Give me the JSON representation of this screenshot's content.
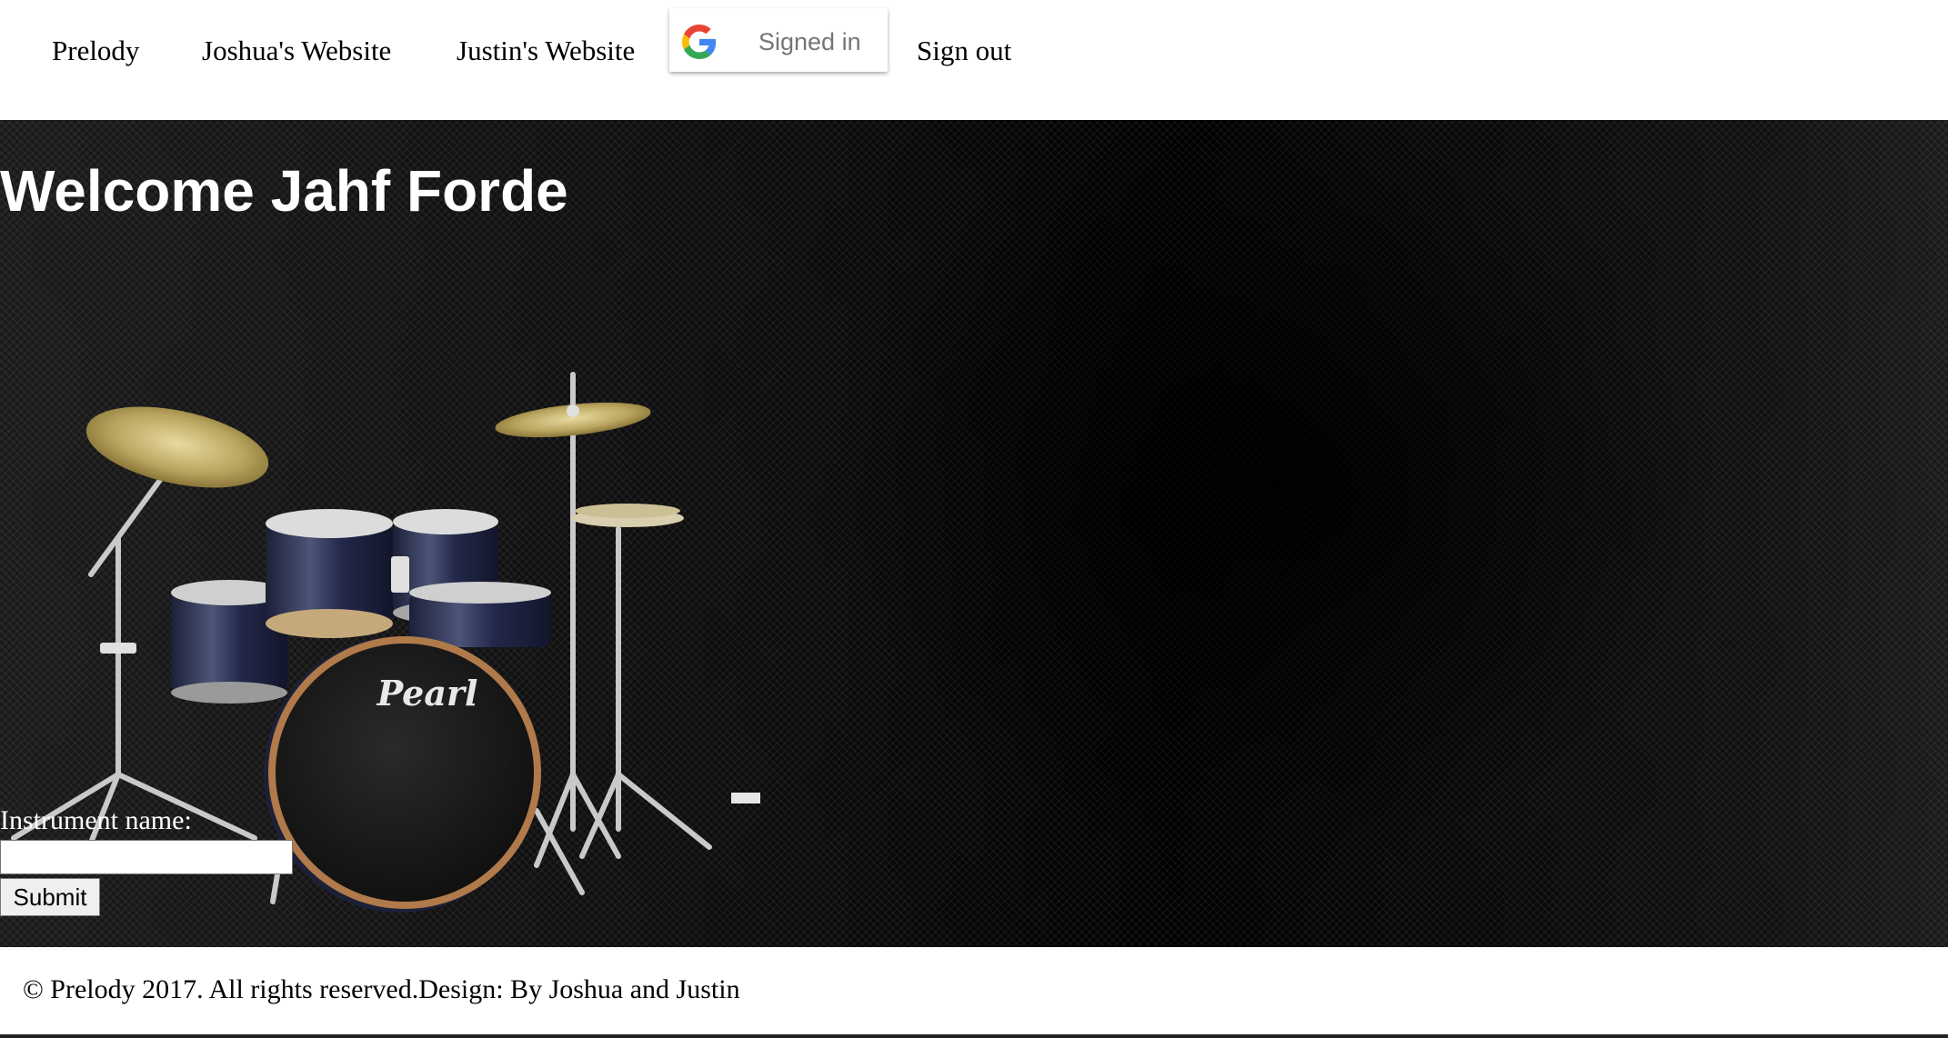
{
  "nav": {
    "links": [
      "Prelody",
      "Joshua's Website",
      "Justin's Website"
    ],
    "google_button_label": "Signed in",
    "sign_out": "Sign out"
  },
  "hero": {
    "welcome": "Welcome Jahf Forde",
    "drum_brand": "Pearl",
    "form": {
      "instrument_label": "Instrument name:",
      "instrument_value": "",
      "submit_label": "Submit"
    }
  },
  "footer": {
    "text": "© Prelody 2017. All rights reserved.Design: By Joshua and Justin"
  },
  "colors": {
    "hero_bg": "#050505",
    "text_on_dark": "#ffffff",
    "google_blue": "#4285F4",
    "google_red": "#EA4335",
    "google_yellow": "#FBBC05",
    "google_green": "#34A853"
  }
}
